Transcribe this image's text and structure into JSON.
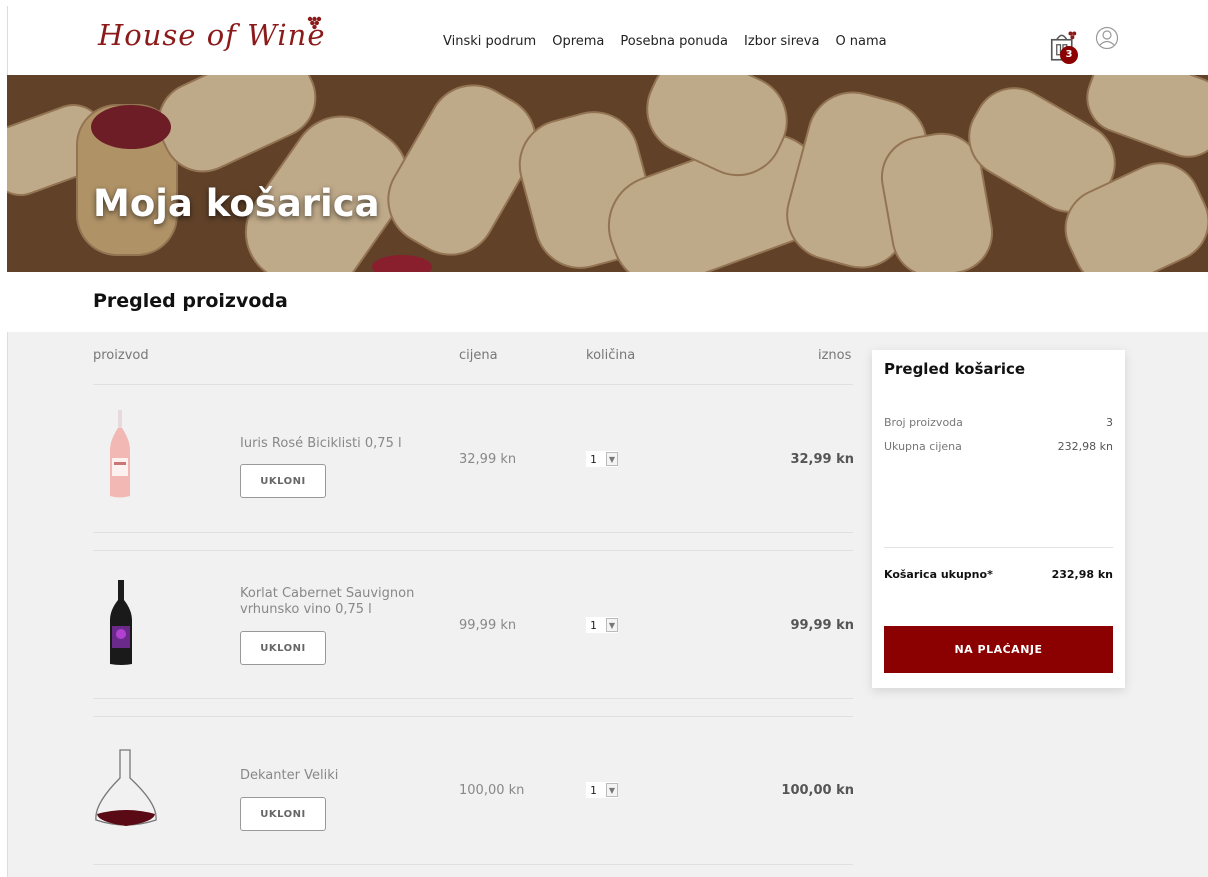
{
  "header": {
    "logo_text": "House of Wine",
    "nav": [
      "Vinski podrum",
      "Oprema",
      "Posebna ponuda",
      "Izbor sireva",
      "O nama"
    ],
    "cart_count": "3"
  },
  "hero": {
    "title": "Moja košarica"
  },
  "section_title": "Pregled proizvoda",
  "columns": {
    "product": "proizvod",
    "price": "cijena",
    "quantity": "količina",
    "amount": "iznos"
  },
  "items": [
    {
      "name": "Iuris Rosé Biciklisti 0,75 l",
      "price": "32,99 kn",
      "qty": "1",
      "amount": "32,99 kn",
      "remove": "UKLONI"
    },
    {
      "name": "Korlat Cabernet Sauvignon vrhunsko vino 0,75 l",
      "price": "99,99 kn",
      "qty": "1",
      "amount": "99,99 kn",
      "remove": "UKLONI"
    },
    {
      "name": "Dekanter Veliki",
      "price": "100,00 kn",
      "qty": "1",
      "amount": "100,00 kn",
      "remove": "UKLONI"
    }
  ],
  "summary": {
    "title": "Pregled košarice",
    "count_label": "Broj proizvoda",
    "count_value": "3",
    "total_label": "Ukupna cijena",
    "total_value": "232,98 kn",
    "grand_label": "Košarica ukupno*",
    "grand_value": "232,98 kn",
    "pay_button": "NA PLAĆANJE"
  },
  "colors": {
    "brand": "#8b0000",
    "background_gray": "#f1f1f1"
  }
}
